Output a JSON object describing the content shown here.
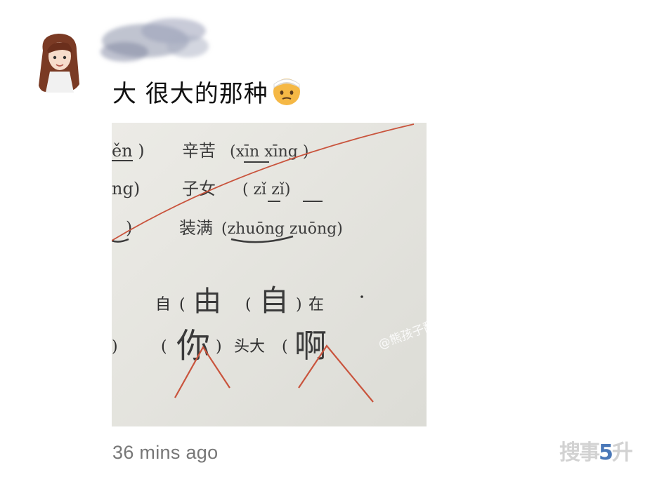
{
  "post": {
    "message": "大 很大的那种",
    "emoji": "face-with-head-bandage-emoji",
    "timestamp": "36 mins ago"
  },
  "photo": {
    "icon": "worksheet-photo",
    "rows": [
      {
        "partial": "ěn )",
        "word": "辛苦",
        "pinyin": "(xīn   xīng )"
      },
      {
        "partial": "ng)",
        "word": "子女",
        "pinyin": "( zǐ   zǐ)"
      },
      {
        "partial": ")",
        "word": "装满",
        "pinyin": "(zhuōng  zuōng)"
      }
    ],
    "fill_row_1": {
      "left": "自",
      "blank_1": "由",
      "blank_2": "自",
      "right": "在"
    },
    "fill_row_2": {
      "left": ")",
      "blank_1": "你",
      "middle": "头大",
      "blank_2": "啊"
    },
    "watermark": "@熊孩子翻车现场",
    "annotation_color": "#c9543d"
  },
  "corner_logo": {
    "text_a": "搜",
    "text_b": "事",
    "text_c": "5",
    "text_d": "升"
  },
  "colors": {
    "message_text": "#111111",
    "timestamp": "#777777",
    "paper": "#e6e6e1"
  }
}
